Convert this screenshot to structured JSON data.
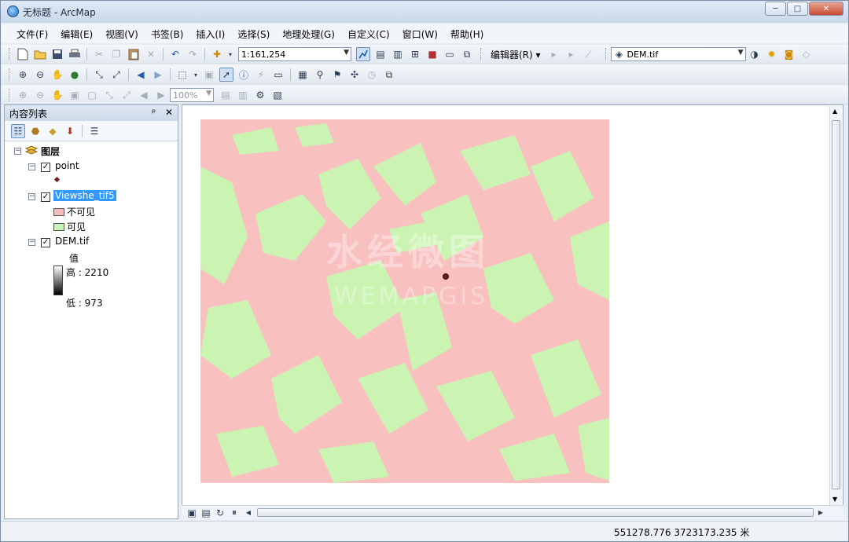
{
  "window": {
    "title": "无标题 - ArcMap",
    "min": "─",
    "max": "□",
    "close": "✕"
  },
  "menu": [
    "文件(F)",
    "编辑(E)",
    "视图(V)",
    "书签(B)",
    "插入(I)",
    "选择(S)",
    "地理处理(G)",
    "自定义(C)",
    "窗口(W)",
    "帮助(H)"
  ],
  "toolbar": {
    "scale_value": "1:161,254",
    "editor_label": "编辑器(R) ▾",
    "layer_combo": "DEM.tif",
    "zoom_percent": "100%"
  },
  "toc": {
    "title": "内容列表",
    "pin": "ᵖ",
    "close": "✕",
    "root_label": "图层",
    "layers": {
      "point": {
        "name": "point",
        "checked": "✓"
      },
      "viewshed": {
        "name": "Viewshe_tif5",
        "checked": "✓",
        "classes": [
          {
            "label": "不可见",
            "color": "#f7bdbd"
          },
          {
            "label": "可见",
            "color": "#c8f5b4"
          }
        ]
      },
      "dem": {
        "name": "DEM.tif",
        "checked": "✓",
        "value_label": "值",
        "high_label": "高 : 2210",
        "low_label": "低 : 973"
      }
    }
  },
  "map": {
    "not_visible_color": "#f9c0c0",
    "visible_color": "#cbf4b3",
    "point_color": "#6b1a1a",
    "watermark_cn": "水经微图",
    "watermark_en": "WEMAPGIS"
  },
  "status": {
    "coordinates": "551278.776  3723173.235 米"
  }
}
